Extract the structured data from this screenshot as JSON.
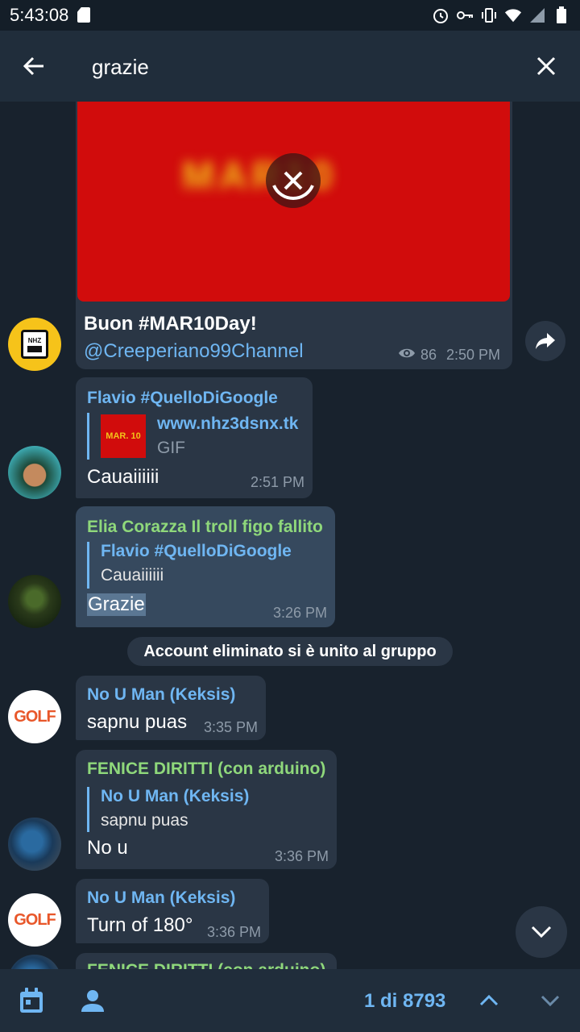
{
  "status": {
    "time": "5:43:08"
  },
  "search": {
    "query": "grazie"
  },
  "messages": [
    {
      "type": "channel_post",
      "title": "Buon #MAR10Day!",
      "link": "@Creeperiano99Channel",
      "views": "86",
      "time": "2:50 PM",
      "media_label": "MAR10"
    },
    {
      "name": "Flavio #QuelloDiGoogle",
      "link_preview": {
        "title": "www.nhz3dsnx.tk",
        "subtitle": "GIF",
        "thumb_label": "MAR. 10"
      },
      "text": "Cauaiiiiii",
      "time": "2:51 PM"
    },
    {
      "name": "Elia Corazza Il troll figo fallito",
      "reply": {
        "name": "Flavio #QuelloDiGoogle",
        "text": "Cauaiiiiii"
      },
      "text": "Grazie",
      "time": "3:26 PM"
    },
    {
      "type": "service",
      "text": "Account eliminato si è unito al gruppo"
    },
    {
      "name": "No U Man (Keksis)",
      "text": "sapnu puas",
      "time": "3:35 PM"
    },
    {
      "name": "FENICE DIRITTI (con arduino)",
      "reply": {
        "name": "No U Man (Keksis)",
        "text": "sapnu puas"
      },
      "text": "No u",
      "time": "3:36 PM"
    },
    {
      "name": "No U Man (Keksis)",
      "text": "Turn of 180°",
      "time": "3:36 PM"
    },
    {
      "name": "FENICE DIRITTI (con arduino)"
    }
  ],
  "avatars": {
    "golf_text": "GOLF",
    "nhz_text": "NHZ"
  },
  "bottom": {
    "counter": "1 di 8793"
  },
  "colors": {
    "accent": "#6fb6f2",
    "green_name": "#8fd87b",
    "bubble": "#2a3645",
    "background": "#18222d"
  }
}
